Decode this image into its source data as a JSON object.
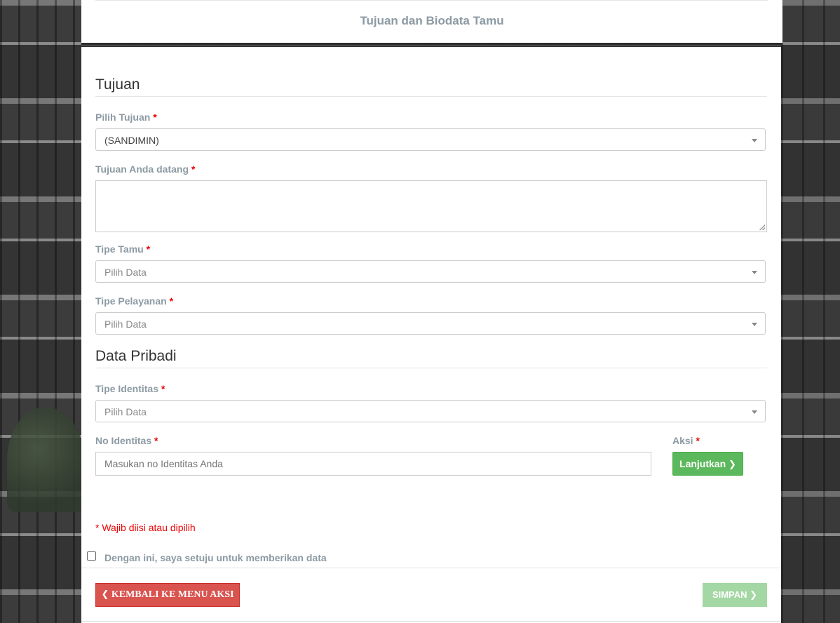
{
  "header": {
    "title": "Tujuan dan Biodata Tamu"
  },
  "sections": {
    "tujuan": "Tujuan",
    "data_pribadi": "Data Pribadi"
  },
  "fields": {
    "pilih_tujuan": {
      "label": "Pilih Tujuan",
      "value": "(SANDIMIN)"
    },
    "tujuan_datang": {
      "label": "Tujuan Anda datang",
      "value": ""
    },
    "tipe_tamu": {
      "label": "Tipe Tamu",
      "value": "Pilih Data"
    },
    "tipe_pelayanan": {
      "label": "Tipe Pelayanan",
      "value": "Pilih Data"
    },
    "tipe_identitas": {
      "label": "Tipe Identitas",
      "value": "Pilih Data"
    },
    "no_identitas": {
      "label": "No Identitas",
      "placeholder": "Masukan no Identitas Anda"
    },
    "aksi": {
      "label": "Aksi"
    }
  },
  "required_mark": "*",
  "buttons": {
    "lanjutkan": "Lanjutkan",
    "kembali": "KEMBALI KE MENU AKSI",
    "simpan": "SIMPAN"
  },
  "note": "* Wajib diisi atau dipilih",
  "agreement": {
    "label": "Dengan ini, saya setuju untuk memberikan data",
    "checked": false
  },
  "colors": {
    "label": "#8c9aa3",
    "required": "#ee0000",
    "success": "#5cb85c",
    "danger": "#d9534f",
    "success_disabled": "#a3d7a3"
  },
  "icons": {
    "chevron_right": "chevron-right-icon",
    "chevron_left": "chevron-left-icon",
    "dropdown": "caret-down-icon"
  }
}
